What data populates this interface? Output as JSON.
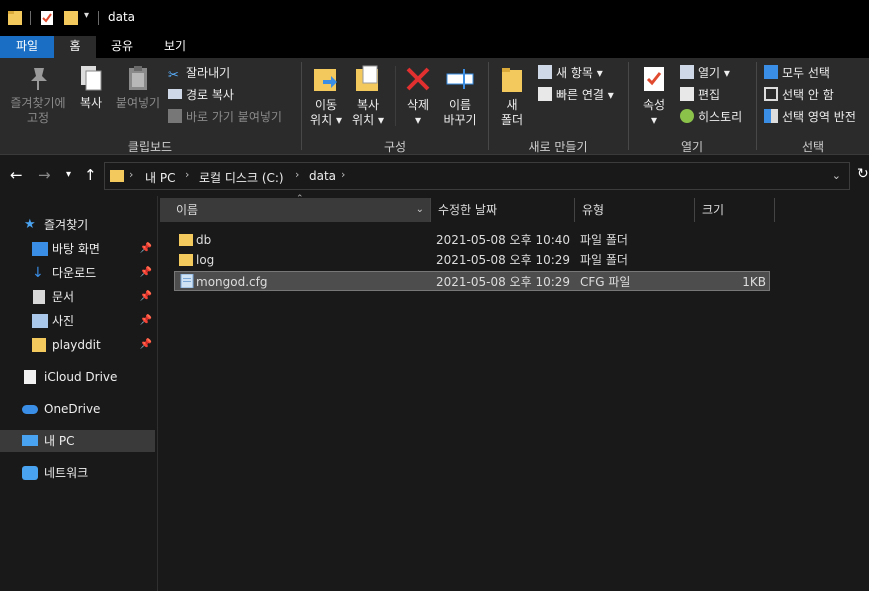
{
  "titlebar": {
    "title": "data"
  },
  "tabs": [
    {
      "label": "파일"
    },
    {
      "label": "홈"
    },
    {
      "label": "공유"
    },
    {
      "label": "보기"
    }
  ],
  "ribbon": {
    "clipboard": {
      "pin_label_1": "즐겨찾기에",
      "pin_label_2": "고정",
      "copy": "복사",
      "paste": "붙여넣기",
      "cut": "잘라내기",
      "copy_path": "경로 복사",
      "paste_shortcut": "바로 가기 붙여넣기",
      "group": "클립보드"
    },
    "organize": {
      "move_1": "이동",
      "move_2": "위치",
      "copyto_1": "복사",
      "copyto_2": "위치",
      "delete": "삭제",
      "rename_1": "이름",
      "rename_2": "바꾸기",
      "group": "구성"
    },
    "new": {
      "folder_1": "새",
      "folder_2": "폴더",
      "new_item": "새 항목",
      "easy_access": "빠른 연결",
      "group": "새로 만들기"
    },
    "open": {
      "properties": "속성",
      "open": "열기",
      "edit": "편집",
      "history": "히스토리",
      "group": "열기"
    },
    "select": {
      "select_all": "모두 선택",
      "select_none": "선택 안 함",
      "invert": "선택 영역 반전",
      "group": "선택"
    }
  },
  "address": {
    "crumbs": [
      "내 PC",
      "로컬 디스크 (C:)",
      "data"
    ]
  },
  "nav": {
    "quick_access": "즐겨찾기",
    "items": [
      {
        "label": "바탕 화면"
      },
      {
        "label": "다운로드"
      },
      {
        "label": "문서"
      },
      {
        "label": "사진"
      },
      {
        "label": "playddit"
      }
    ],
    "icloud": "iCloud Drive",
    "onedrive": "OneDrive",
    "thispc": "내 PC",
    "network": "네트워크"
  },
  "columns": {
    "name": "이름",
    "modified": "수정한 날짜",
    "type": "유형",
    "size": "크기"
  },
  "files": [
    {
      "name": "db",
      "modified": "2021-05-08 오후 10:40",
      "type": "파일 폴더",
      "size": ""
    },
    {
      "name": "log",
      "modified": "2021-05-08 오후 10:29",
      "type": "파일 폴더",
      "size": ""
    },
    {
      "name": "mongod.cfg",
      "modified": "2021-05-08 오후 10:29",
      "type": "CFG 파일",
      "size": "1KB"
    }
  ],
  "colors": {
    "accent": "#1a6fc4",
    "folder": "#f3c85d",
    "delete": "#e22f2f"
  }
}
